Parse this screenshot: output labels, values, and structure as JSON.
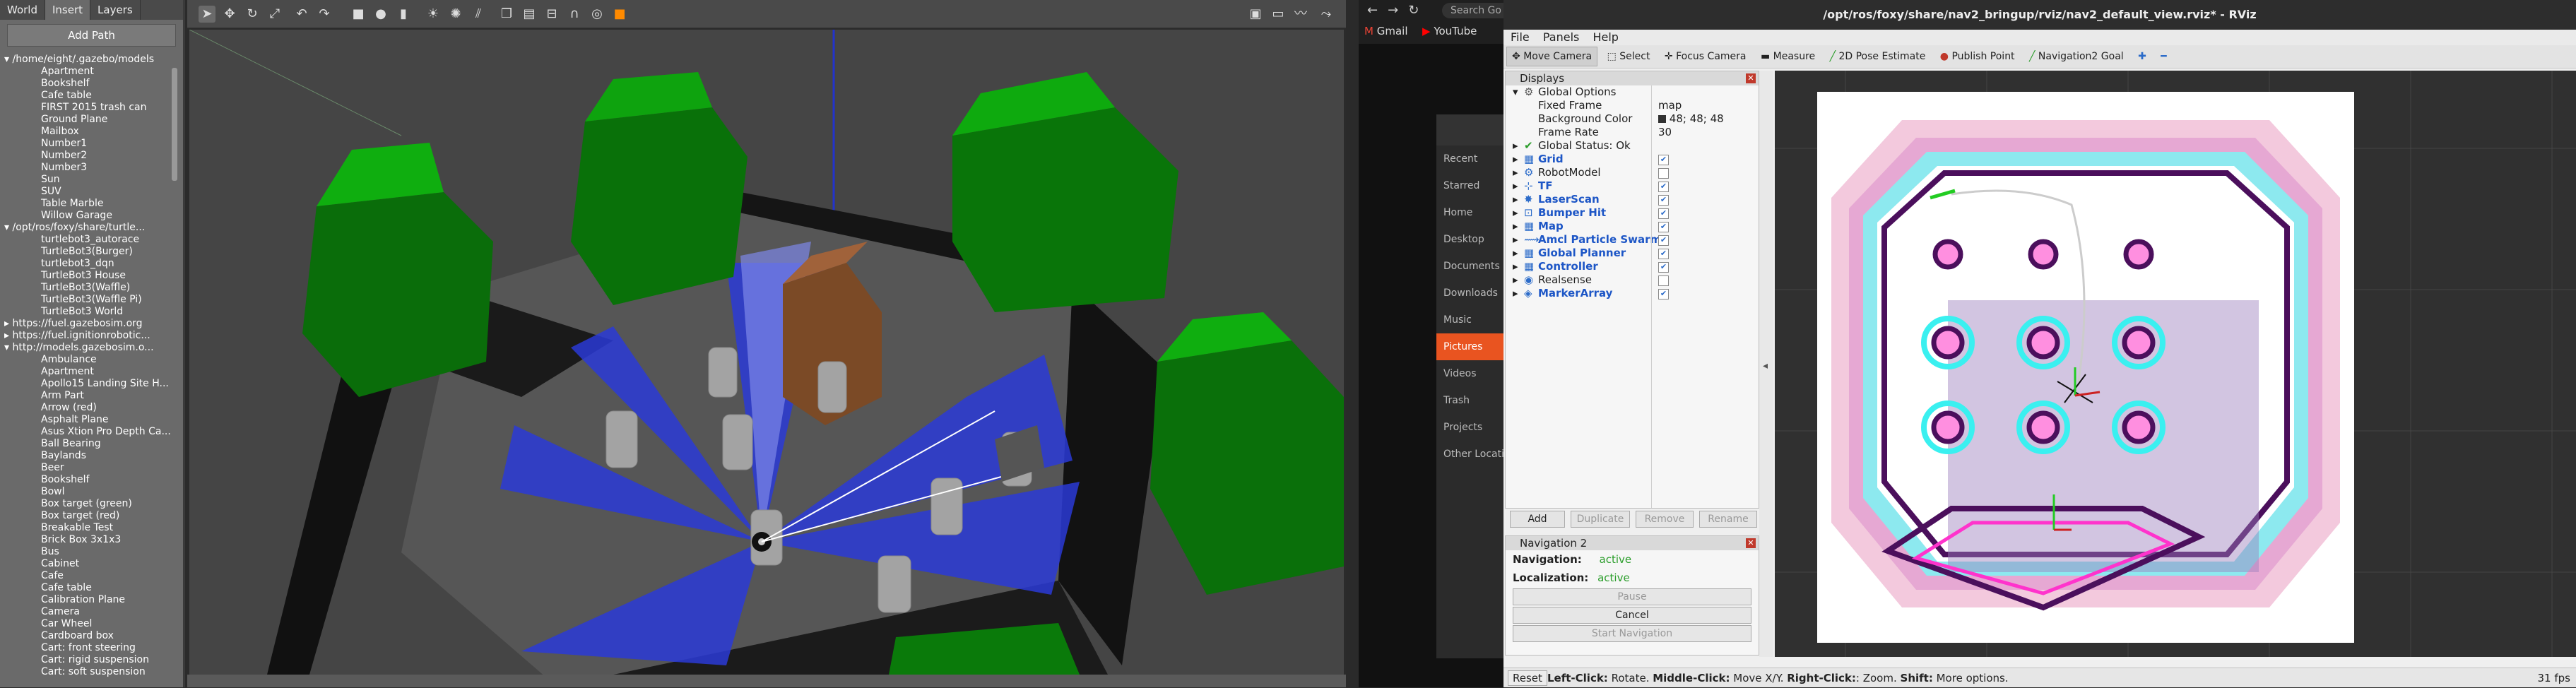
{
  "gazebo": {
    "tabs": [
      "World",
      "Insert",
      "Layers"
    ],
    "add_path": "Add Path",
    "tree": [
      {
        "group": "/home/eight/.gazebo/models",
        "items": [
          "Apartment",
          "Bookshelf",
          "Cafe table",
          "FIRST 2015 trash can",
          "Ground Plane",
          "Mailbox",
          "Number1",
          "Number2",
          "Number3",
          "Sun",
          "SUV",
          "Table Marble",
          "Willow Garage"
        ]
      },
      {
        "group": "/opt/ros/foxy/share/turtle...",
        "items": [
          "turtlebot3_autorace",
          "TurtleBot3(Burger)",
          "turtlebot3_dqn",
          "TurtleBot3 House",
          "TurtleBot3(Waffle)",
          "TurtleBot3(Waffle Pi)",
          "TurtleBot3 World"
        ]
      },
      {
        "group": "https://fuel.gazebosim.org",
        "items": []
      },
      {
        "group": "https://fuel.ignitionrobotic...",
        "items": []
      },
      {
        "group": "http://models.gazebosim.o...",
        "items": [
          "Ambulance",
          "Apartment",
          "Apollo15 Landing Site H...",
          "Arm Part",
          "Arrow (red)",
          "Asphalt Plane",
          "Asus Xtion Pro Depth Ca...",
          "Ball Bearing",
          "Baylands",
          "Beer",
          "Bookshelf",
          "Bowl",
          "Box target (green)",
          "Box target (red)",
          "Breakable Test",
          "Brick Box 3x1x3",
          "Bus",
          "Cabinet",
          "Cafe",
          "Cafe table",
          "Calibration Plane",
          "Camera",
          "Car Wheel",
          "Cardboard box",
          "Cart: front steering",
          "Cart: rigid suspension",
          "Cart: soft suspension"
        ]
      }
    ]
  },
  "browser": {
    "search_placeholder": "Search Go",
    "bookmarks": [
      "Gmail",
      "YouTube"
    ],
    "files": [
      "Recent",
      "Starred",
      "Home",
      "Desktop",
      "Documents",
      "Downloads",
      "Music",
      "Pictures",
      "Videos",
      "Trash",
      "Projects",
      "Other Locations"
    ],
    "selected_file": "Pictures"
  },
  "rviz": {
    "title": "/opt/ros/foxy/share/nav2_bringup/rviz/nav2_default_view.rviz* - RViz",
    "menu": [
      "File",
      "Panels",
      "Help"
    ],
    "tools": [
      "Move Camera",
      "Select",
      "Focus Camera",
      "Measure",
      "2D Pose Estimate",
      "Publish Point",
      "Navigation2 Goal"
    ],
    "displays_title": "Displays",
    "global_options": {
      "label": "Global Options",
      "fixed_frame": "map",
      "background_color": "48; 48; 48",
      "frame_rate": "30"
    },
    "global_options_labels": {
      "fixed_frame": "Fixed Frame",
      "background_color": "Background Color",
      "frame_rate": "Frame Rate"
    },
    "global_status": "Global Status: Ok",
    "display_items": [
      {
        "name": "Grid",
        "checked": true,
        "blue": true
      },
      {
        "name": "RobotModel",
        "checked": false,
        "blue": false
      },
      {
        "name": "TF",
        "checked": true,
        "blue": true
      },
      {
        "name": "LaserScan",
        "checked": true,
        "blue": true
      },
      {
        "name": "Bumper Hit",
        "checked": true,
        "blue": true
      },
      {
        "name": "Map",
        "checked": true,
        "blue": true
      },
      {
        "name": "Amcl Particle Swarm",
        "checked": true,
        "blue": true
      },
      {
        "name": "Global Planner",
        "checked": true,
        "blue": true
      },
      {
        "name": "Controller",
        "checked": true,
        "blue": true
      },
      {
        "name": "Realsense",
        "checked": false,
        "blue": false
      },
      {
        "name": "MarkerArray",
        "checked": true,
        "blue": true
      }
    ],
    "display_buttons": [
      "Add",
      "Duplicate",
      "Remove",
      "Rename"
    ],
    "nav_panel": {
      "title": "Navigation 2",
      "navigation_label": "Navigation:",
      "navigation_value": "active",
      "localization_label": "Localization:",
      "localization_value": "active",
      "buttons": [
        "Pause",
        "Cancel",
        "Start Navigation"
      ]
    },
    "status": {
      "reset": "Reset",
      "hint_bold1": "Left-Click:",
      "hint1": " Rotate. ",
      "hint_bold2": "Middle-Click:",
      "hint2": " Move X/Y. ",
      "hint_bold3": "Right-Click:",
      "hint3": ": Zoom. ",
      "hint_bold4": "Shift:",
      "hint4": " More options.",
      "fps": "31 fps"
    }
  }
}
